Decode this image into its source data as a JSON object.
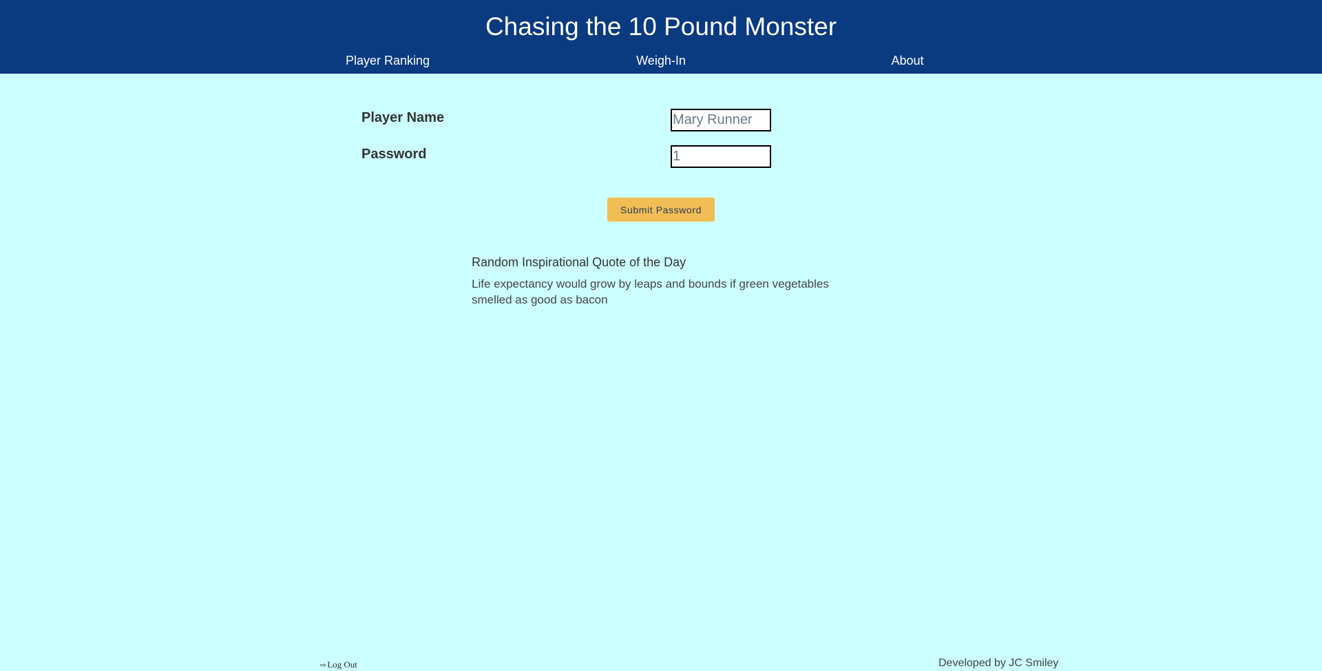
{
  "header": {
    "title": "Chasing the 10 Pound Monster",
    "nav": {
      "ranking": "Player Ranking",
      "weigh_in": "Weigh-In",
      "about": "About"
    }
  },
  "form": {
    "name_label": "Player Name",
    "name_placeholder": "Mary Runner",
    "password_label": "Password",
    "password_placeholder": "1",
    "submit_label": "Submit Password"
  },
  "quote": {
    "heading": "Random Inspirational Quote of the Day",
    "text": "Life expectancy would grow by leaps and bounds if green vegetables smelled as good as bacon"
  },
  "footer": {
    "logout_icon": "⇨",
    "logout_label": "Log Out",
    "credit": "Developed by JC Smiley"
  },
  "colors": {
    "header_bg": "#0a3a80",
    "page_bg": "#ccffff",
    "button_bg": "#f0be55"
  }
}
